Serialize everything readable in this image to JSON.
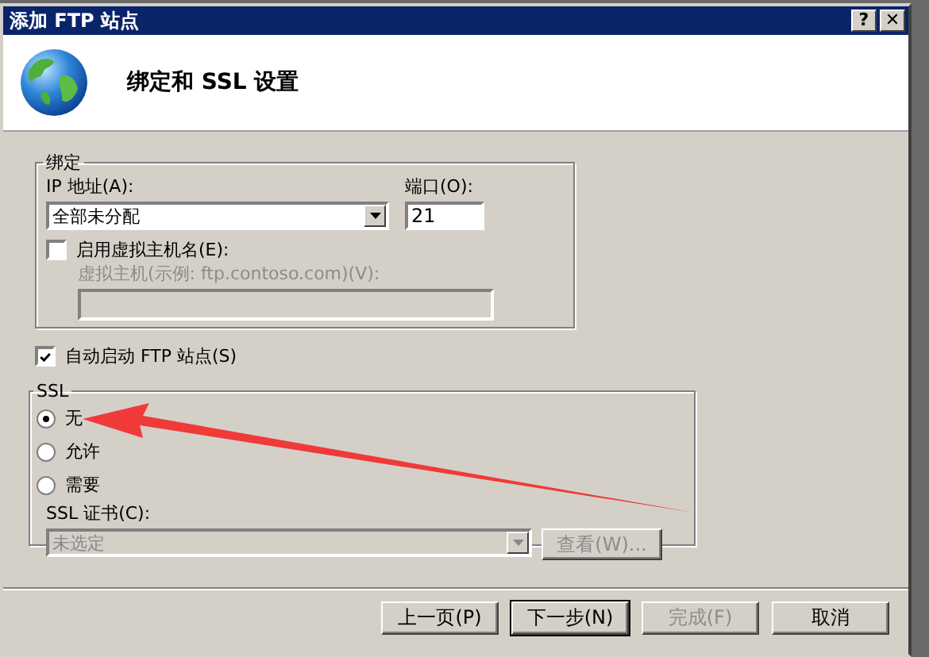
{
  "window": {
    "title": "添加 FTP 站点",
    "title_buttons": [
      {
        "kind": "help",
        "label": "?"
      },
      {
        "kind": "close",
        "label": "✕"
      }
    ]
  },
  "header": {
    "title": "绑定和 SSL 设置"
  },
  "binding": {
    "legend": "绑定",
    "ip_label": "IP 地址(A):",
    "ip_value": "全部未分配",
    "port_label": "端口(O):",
    "port_value": "21",
    "hostname_checkbox": {
      "label": "启用虚拟主机名(E):",
      "checked": false
    },
    "hostname_label": "虚拟主机(示例: ftp.contoso.com)(V):",
    "hostname_disabled": true
  },
  "autostart": {
    "label": "自动启动 FTP 站点(S)",
    "checked": true
  },
  "ssl": {
    "legend": "SSL",
    "options": [
      {
        "label": "无",
        "selected": true
      },
      {
        "label": "允许",
        "selected": false
      },
      {
        "label": "需要",
        "selected": false
      }
    ],
    "cert_label": "SSL 证书(C):",
    "cert_value": "未选定",
    "cert_disabled": true,
    "view_button": {
      "label": "查看(W)...",
      "disabled": true
    }
  },
  "buttons": [
    {
      "label": "上一页(P)",
      "disabled": false,
      "default": false
    },
    {
      "label": "下一步(N)",
      "disabled": false,
      "default": true
    },
    {
      "label": "完成(F)",
      "disabled": true,
      "default": false
    },
    {
      "label": "取消",
      "disabled": false,
      "default": false
    }
  ]
}
